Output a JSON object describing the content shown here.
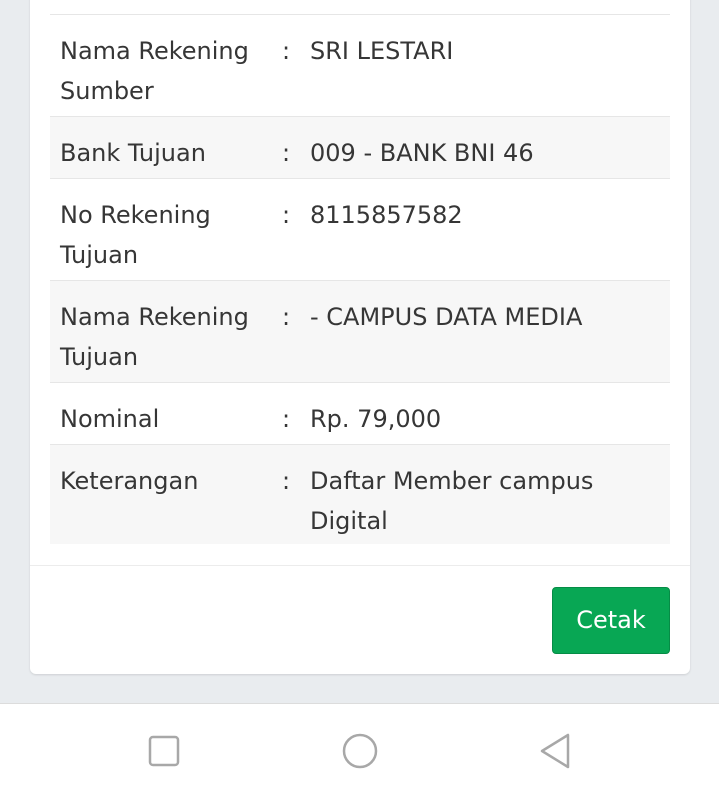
{
  "details": {
    "rows": [
      {
        "label": "Nama Rekening Sumber",
        "separator": ":",
        "value": "SRI LESTARI"
      },
      {
        "label": "Bank Tujuan",
        "separator": ":",
        "value": "009 - BANK BNI 46"
      },
      {
        "label": "No Rekening Tujuan",
        "separator": ":",
        "value": "8115857582"
      },
      {
        "label": "Nama Rekening Tujuan",
        "separator": ":",
        "value": "- CAMPUS DATA MEDIA"
      },
      {
        "label": "Nominal",
        "separator": ":",
        "value": "Rp. 79,000"
      },
      {
        "label": "Keterangan",
        "separator": ":",
        "value": "Daftar Member campus Digital"
      }
    ]
  },
  "footer": {
    "print_label": "Cetak"
  },
  "colors": {
    "print_button": "#08a754",
    "background": "#e9ecef",
    "card": "#ffffff",
    "row_stripe": "#f7f7f7"
  },
  "system_nav": {
    "icons": [
      "square-recents-icon",
      "circle-home-icon",
      "triangle-back-icon"
    ]
  }
}
